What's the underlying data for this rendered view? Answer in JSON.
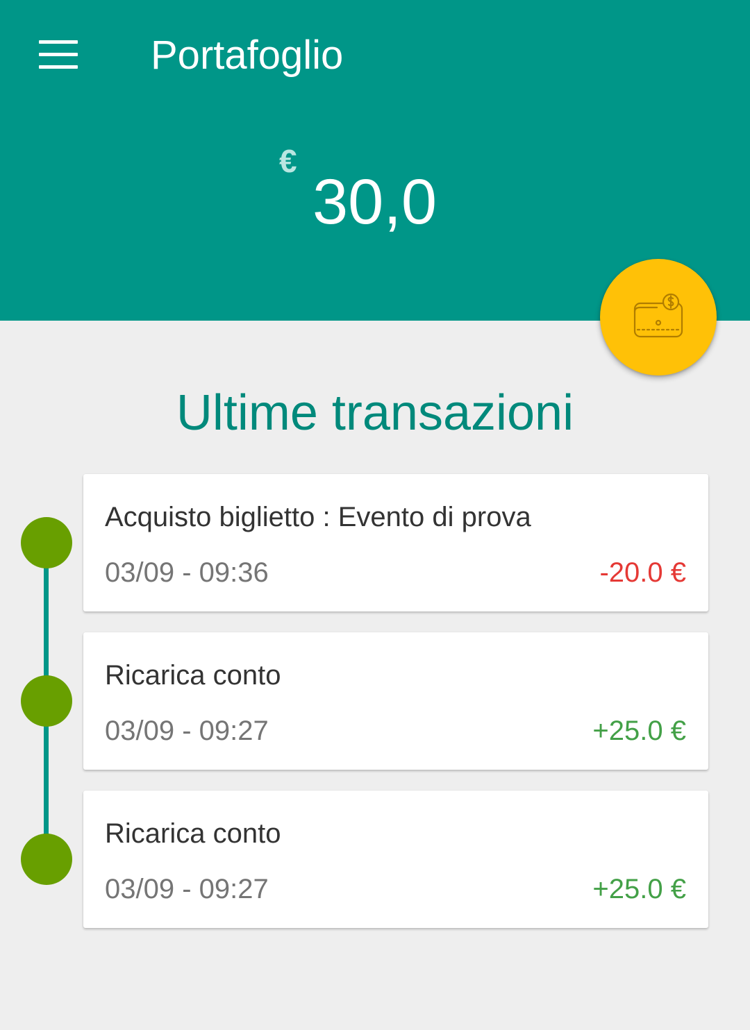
{
  "header": {
    "title": "Portafoglio",
    "currency_symbol": "€",
    "balance": "30,0",
    "bg_color": "#009688"
  },
  "menu": {
    "icon": "menu-icon"
  },
  "fab": {
    "icon": "wallet-icon",
    "color": "#ffc107"
  },
  "transactions": {
    "heading": "Ultime transazioni",
    "items": [
      {
        "title": "Acquisto biglietto : Evento di prova",
        "date": "03/09 - 09:36",
        "amount": "-20.0 €",
        "amount_color": "#e53935"
      },
      {
        "title": "Ricarica conto",
        "date": "03/09 - 09:27",
        "amount": "+25.0 €",
        "amount_color": "#43a047"
      },
      {
        "title": "Ricarica conto",
        "date": "03/09 - 09:27",
        "amount": "+25.0 €",
        "amount_color": "#43a047"
      }
    ]
  },
  "colors": {
    "accent": "#00897b",
    "timeline_dot": "#689f00",
    "negative": "#e53935",
    "positive": "#43a047"
  }
}
